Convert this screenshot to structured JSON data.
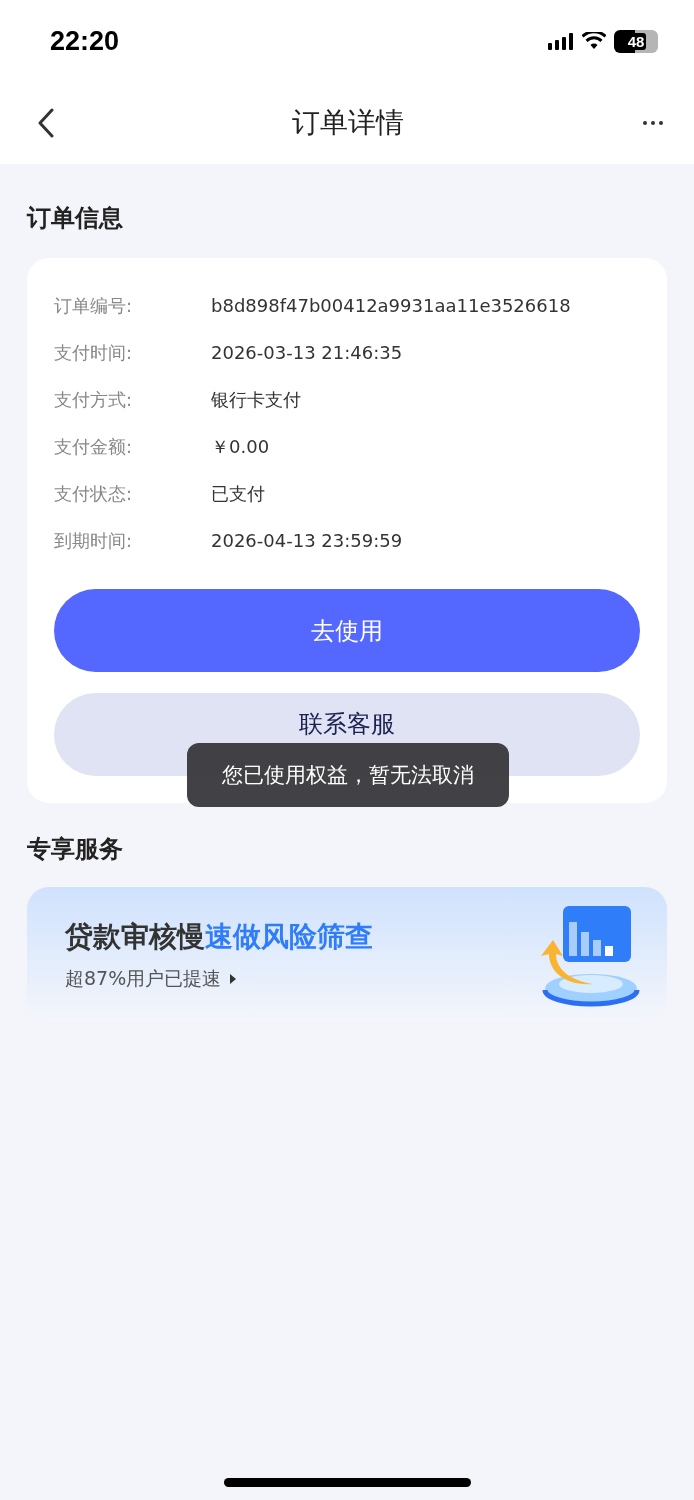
{
  "status_bar": {
    "time": "22:20",
    "battery": "48"
  },
  "nav": {
    "title": "订单详情"
  },
  "order_section": {
    "title": "订单信息",
    "fields": [
      {
        "label": "订单编号:",
        "value": "b8d898f47b00412a9931aa11e3526618"
      },
      {
        "label": "支付时间:",
        "value": "2026-03-13 21:46:35"
      },
      {
        "label": "支付方式:",
        "value": "银行卡支付"
      },
      {
        "label": "支付金额:",
        "value": "￥0.00"
      },
      {
        "label": "支付状态:",
        "value": "已支付"
      },
      {
        "label": "到期时间:",
        "value": "2026-04-13 23:59:59"
      }
    ],
    "buttons": [
      {
        "kind": "primary",
        "label": "去使用"
      },
      {
        "kind": "secondary",
        "label": "联系客服"
      }
    ]
  },
  "toast": "您已使用权益，暂无法取消",
  "service_section": {
    "title": "专享服务",
    "banner": {
      "title_lead": "贷款审核慢",
      "title_highlight": "速做风险筛查",
      "subtitle": "超87%用户已提速"
    }
  }
}
